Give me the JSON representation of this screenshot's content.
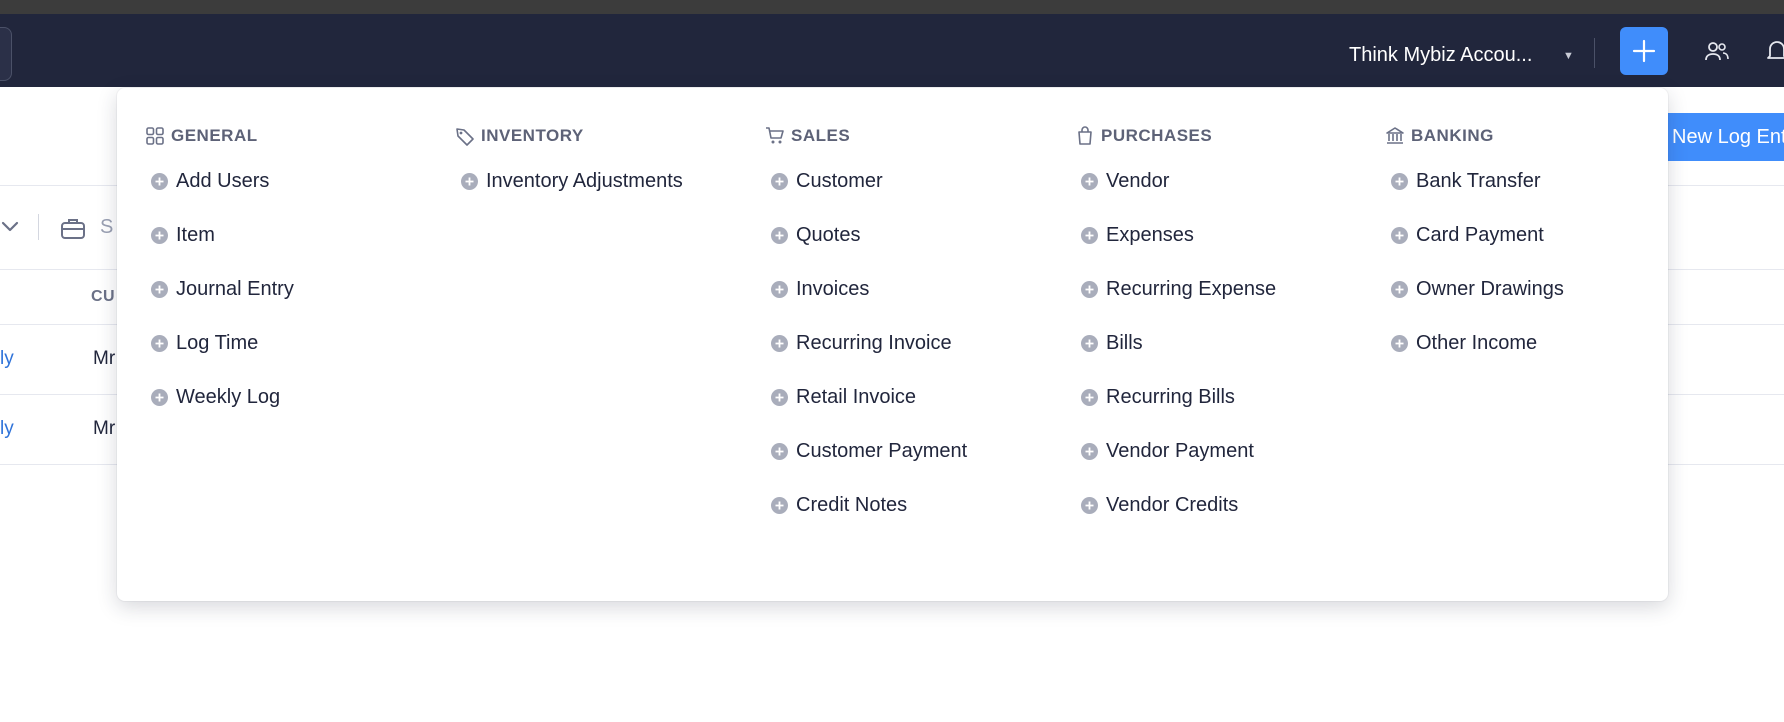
{
  "header": {
    "org_name": "Think Mybiz Accou...",
    "new_entry_label": "New Log Ent"
  },
  "filter": {
    "search_placeholder": "S"
  },
  "table": {
    "column_header": "CU",
    "rows": [
      {
        "link": "ly",
        "customer": "Mr"
      },
      {
        "link": "ly",
        "customer": "Mr"
      }
    ]
  },
  "quick_create": {
    "columns": [
      {
        "title": "GENERAL",
        "icon": "grid-icon",
        "items": [
          "Add Users",
          "Item",
          "Journal Entry",
          "Log Time",
          "Weekly Log"
        ]
      },
      {
        "title": "INVENTORY",
        "icon": "tag-icon",
        "items": [
          "Inventory Adjustments"
        ]
      },
      {
        "title": "SALES",
        "icon": "cart-icon",
        "items": [
          "Customer",
          "Quotes",
          "Invoices",
          "Recurring Invoice",
          "Retail Invoice",
          "Customer Payment",
          "Credit Notes"
        ]
      },
      {
        "title": "PURCHASES",
        "icon": "shopping-bag-icon",
        "items": [
          "Vendor",
          "Expenses",
          "Recurring Expense",
          "Bills",
          "Recurring Bills",
          "Vendor Payment",
          "Vendor Credits"
        ]
      },
      {
        "title": "BANKING",
        "icon": "bank-icon",
        "items": [
          "Bank Transfer",
          "Card Payment",
          "Owner Drawings",
          "Other Income"
        ]
      }
    ]
  },
  "colors": {
    "topbar_bg": "#21263c",
    "accent": "#408dfb",
    "link": "#2f73d9"
  }
}
